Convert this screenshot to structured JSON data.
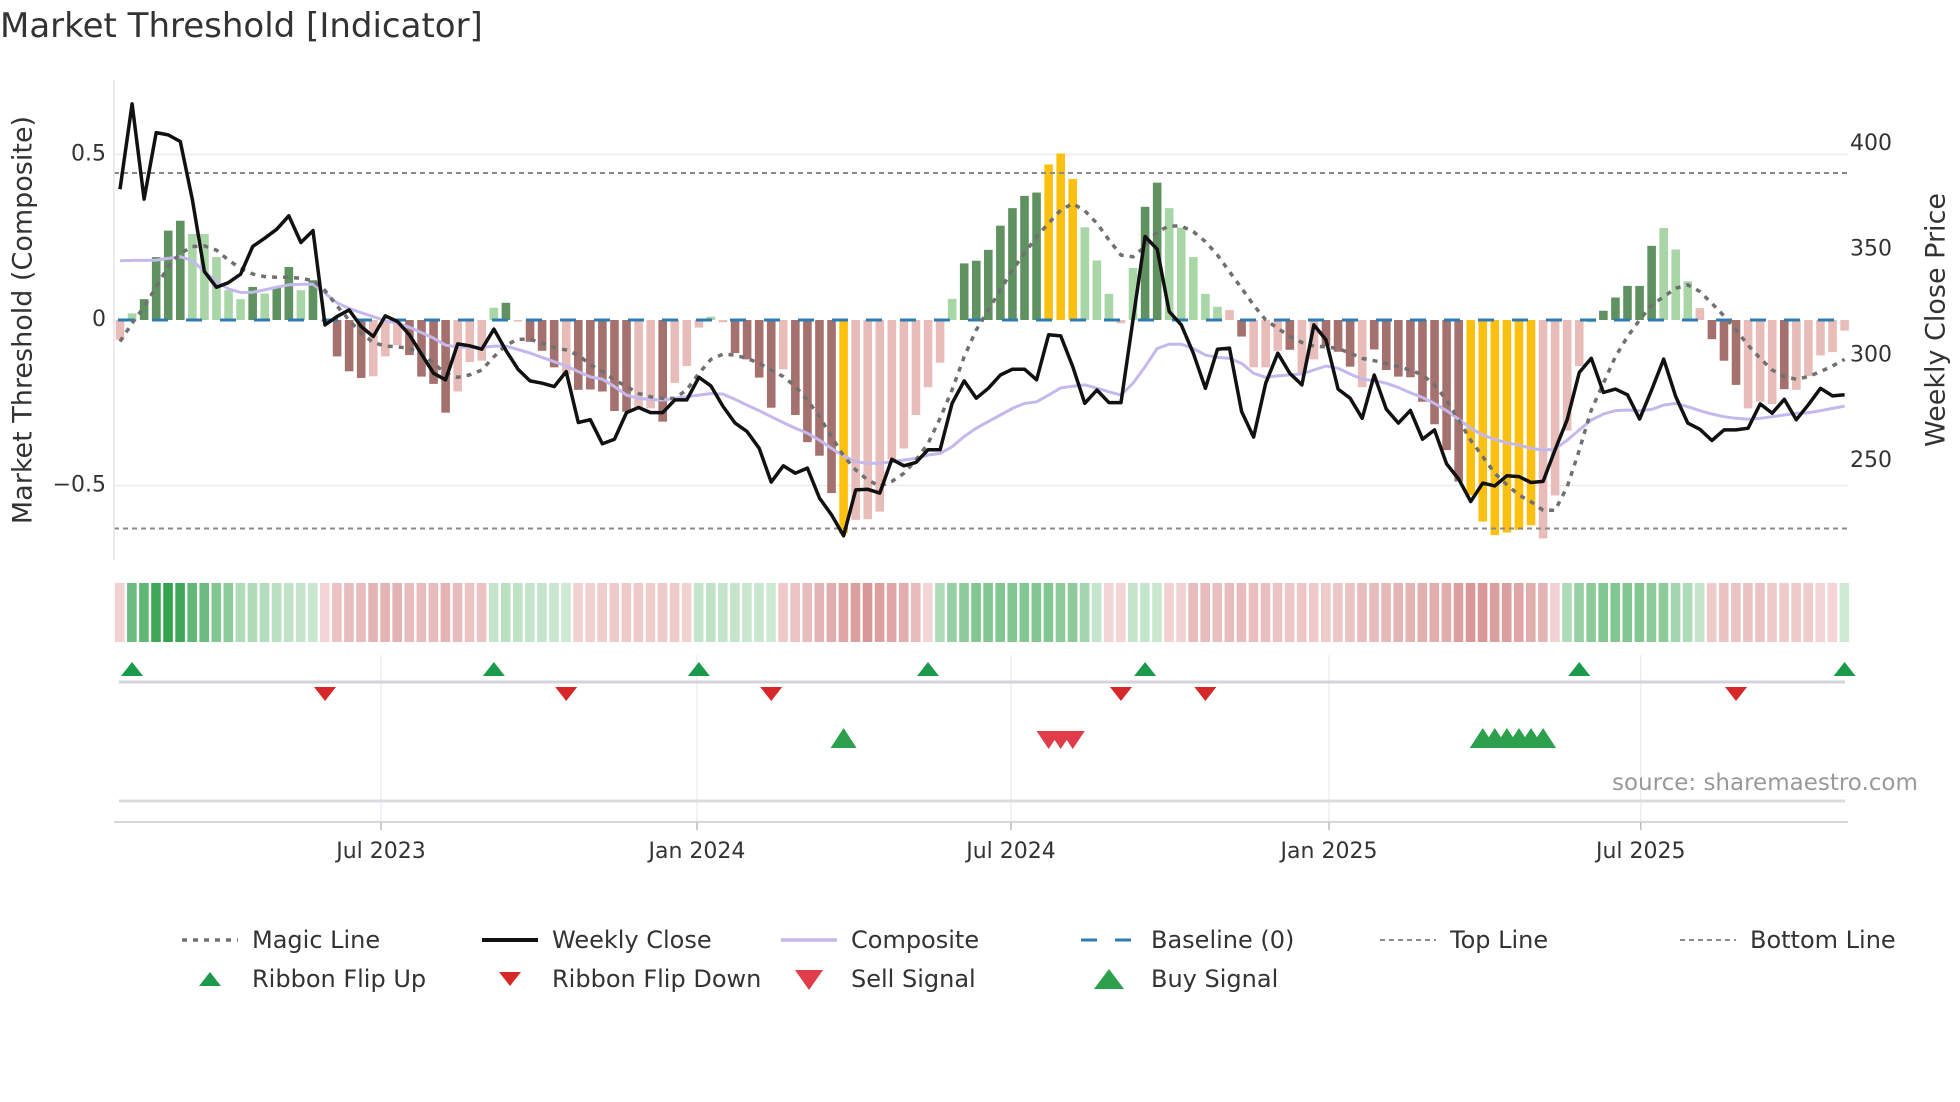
{
  "title": "Market Threshold [Indicator]",
  "source": "source: sharemaestro.com",
  "colors": {
    "bar_dark_green": "#5f9260",
    "bar_light_green": "#a9d6a6",
    "bar_dark_red": "#a5716e",
    "bar_light_red": "#e8bdb9",
    "bar_extreme": "#fcc010",
    "close": "#111111",
    "composite": "#c4b8ec",
    "magic": "#707070",
    "baseline": "#2f7cb3",
    "threshold": "#8a8a8a",
    "flip_up": "#1a9a4a",
    "flip_down": "#d62828",
    "sell": "#e03c4a",
    "buy": "#2ca04c"
  },
  "chart_data": {
    "type": "bar+line",
    "title": "Market Threshold [Indicator]",
    "ylabel_left": "Market Threshold (Composite)",
    "ylabel_right": "Weekly Close Price",
    "ylim_left": [
      -0.74,
      0.72
    ],
    "ylim_right": [
      188,
      432
    ],
    "yticks_left": [
      {
        "v": 0.5,
        "label": "0.5"
      },
      {
        "v": 0,
        "label": "0"
      },
      {
        "v": -0.5,
        "label": "−0.5"
      }
    ],
    "yticks_right": [
      {
        "v": 400,
        "label": "400"
      },
      {
        "v": 350,
        "label": "350"
      },
      {
        "v": 300,
        "label": "300"
      },
      {
        "v": 250,
        "label": "250"
      }
    ],
    "xticks": [
      {
        "week": 21.64,
        "label": "Jul 2023"
      },
      {
        "week": 47.84,
        "label": "Jan 2024"
      },
      {
        "week": 73.88,
        "label": "Jul 2024"
      },
      {
        "week": 100.25,
        "label": "Jan 2025"
      },
      {
        "week": 126.1,
        "label": "Jul 2025"
      }
    ],
    "top_line": 0.444,
    "bottom_line": -0.63,
    "baseline": 0,
    "composite_bars": [
      -0.06,
      0.02,
      0.063,
      0.19,
      0.27,
      0.3,
      0.26,
      0.26,
      0.19,
      0.09,
      0.063,
      0.1,
      0.08,
      0.1,
      0.16,
      0.09,
      0.12,
      0,
      -0.11,
      -0.155,
      -0.175,
      -0.17,
      -0.11,
      -0.076,
      -0.106,
      -0.171,
      -0.193,
      -0.28,
      -0.216,
      -0.127,
      -0.123,
      0.037,
      0.052,
      -0.005,
      -0.066,
      -0.093,
      -0.143,
      -0.164,
      -0.211,
      -0.21,
      -0.216,
      -0.275,
      -0.277,
      -0.267,
      -0.267,
      -0.307,
      -0.19,
      -0.139,
      -0.023,
      0.01,
      -0.007,
      -0.1,
      -0.119,
      -0.174,
      -0.265,
      -0.149,
      -0.287,
      -0.369,
      -0.41,
      -0.523,
      -0.644,
      -0.604,
      -0.602,
      -0.579,
      -0.421,
      -0.388,
      -0.287,
      -0.203,
      -0.129,
      0.064,
      0.171,
      0.179,
      0.212,
      0.285,
      0.338,
      0.375,
      0.385,
      0.47,
      0.503,
      0.426,
      0.28,
      0.18,
      0.079,
      -0.01,
      0.157,
      0.342,
      0.415,
      0.338,
      0.279,
      0.19,
      0.079,
      0.04,
      0.03,
      -0.05,
      -0.143,
      -0.143,
      -0.093,
      -0.09,
      -0.16,
      -0.119,
      -0.079,
      -0.096,
      -0.141,
      -0.203,
      -0.089,
      -0.151,
      -0.171,
      -0.173,
      -0.247,
      -0.315,
      -0.393,
      -0.488,
      -0.529,
      -0.609,
      -0.65,
      -0.642,
      -0.634,
      -0.62,
      -0.66,
      -0.53,
      -0.334,
      -0.139,
      -0.007,
      0.028,
      0.068,
      0.103,
      0.103,
      0.224,
      0.278,
      0.213,
      0.117,
      0.036,
      -0.058,
      -0.123,
      -0.196,
      -0.267,
      -0.247,
      -0.254,
      -0.209,
      -0.211,
      -0.169,
      -0.107,
      -0.097,
      -0.032
    ],
    "bar_states": "rgGGGGgggggGgGGgGrRRRrrrRRRRrrrgGrRRRrRRRRRrrRrrrgrRRRRrRRRRYrrrrrrrrgGGGGGGGYYYgggrgGGgggggrRrrrRrrRRRrRRRRRRRRYYYYYYrrrrgGGGGGgggrRRRrrrRrrrr",
    "weekly_close": [
      378.6,
      419,
      373.9,
      405.4,
      404.3,
      401.2,
      373.6,
      339.6,
      332.2,
      334.4,
      338.4,
      351.5,
      355.4,
      359.7,
      366,
      353.4,
      359,
      314.4,
      318.4,
      321.5,
      313.6,
      308.9,
      318.7,
      316,
      309.7,
      300.5,
      291.5,
      288.4,
      305.4,
      304.5,
      302.9,
      312.4,
      302.3,
      293.4,
      287.9,
      286.8,
      285.2,
      292.3,
      268.2,
      269.5,
      258.1,
      260.3,
      272.9,
      275.3,
      272.9,
      272.9,
      278.9,
      278.9,
      289.6,
      285.5,
      275.8,
      267.9,
      263.9,
      256,
      240,
      247.7,
      244.2,
      246.6,
      232.4,
      224.5,
      214.6,
      236.3,
      236.6,
      234.8,
      250.8,
      247.7,
      249.3,
      255.3,
      255.3,
      277.3,
      287.9,
      279.7,
      284.4,
      290.7,
      293.4,
      293.4,
      288.4,
      309.7,
      309.2,
      294.7,
      277.3,
      283.6,
      277.6,
      277.6,
      316.8,
      356.2,
      350.2,
      320.7,
      314.4,
      301,
      284.4,
      302.9,
      303.4,
      273.4,
      261.3,
      286.8,
      301,
      291.5,
      286,
      314.4,
      307.3,
      284,
      279.7,
      270.2,
      290.7,
      274.5,
      267.9,
      273.9,
      260.3,
      264.7,
      248.6,
      241.4,
      230.8,
      239.5,
      238.2,
      243,
      242.6,
      239.8,
      240.3,
      255.3,
      269.5,
      291.9,
      298.6,
      282.4,
      284,
      281.3,
      269.8,
      283.6,
      298.2,
      280.5,
      267.9,
      265,
      259.7,
      264.7,
      264.7,
      265.5,
      277,
      272.6,
      279.2,
      269.5,
      276.6,
      284.4,
      280.8,
      281.3
    ],
    "composite": [
      0.179,
      0.18,
      0.18,
      0.181,
      0.186,
      0.191,
      0.18,
      0.146,
      0.116,
      0.094,
      0.083,
      0.084,
      0.091,
      0.099,
      0.106,
      0.108,
      0.108,
      0.081,
      0.052,
      0.035,
      0.022,
      0.01,
      -0.002,
      -0.01,
      -0.022,
      -0.038,
      -0.055,
      -0.076,
      -0.081,
      -0.083,
      -0.083,
      -0.079,
      -0.079,
      -0.089,
      -0.1,
      -0.113,
      -0.126,
      -0.139,
      -0.156,
      -0.172,
      -0.179,
      -0.201,
      -0.227,
      -0.237,
      -0.24,
      -0.242,
      -0.237,
      -0.232,
      -0.227,
      -0.222,
      -0.224,
      -0.24,
      -0.257,
      -0.274,
      -0.292,
      -0.31,
      -0.327,
      -0.342,
      -0.363,
      -0.388,
      -0.411,
      -0.428,
      -0.433,
      -0.433,
      -0.428,
      -0.423,
      -0.418,
      -0.408,
      -0.403,
      -0.383,
      -0.352,
      -0.327,
      -0.307,
      -0.287,
      -0.267,
      -0.252,
      -0.247,
      -0.227,
      -0.205,
      -0.2,
      -0.196,
      -0.206,
      -0.217,
      -0.227,
      -0.191,
      -0.141,
      -0.086,
      -0.073,
      -0.073,
      -0.086,
      -0.106,
      -0.113,
      -0.116,
      -0.131,
      -0.161,
      -0.173,
      -0.169,
      -0.166,
      -0.163,
      -0.151,
      -0.139,
      -0.146,
      -0.163,
      -0.179,
      -0.183,
      -0.191,
      -0.204,
      -0.22,
      -0.234,
      -0.252,
      -0.274,
      -0.3,
      -0.327,
      -0.347,
      -0.361,
      -0.371,
      -0.378,
      -0.388,
      -0.393,
      -0.39,
      -0.363,
      -0.332,
      -0.302,
      -0.284,
      -0.274,
      -0.272,
      -0.274,
      -0.27,
      -0.257,
      -0.252,
      -0.262,
      -0.274,
      -0.284,
      -0.292,
      -0.297,
      -0.3,
      -0.297,
      -0.292,
      -0.287,
      -0.282,
      -0.28,
      -0.274,
      -0.267,
      -0.26
    ],
    "magic_line": [
      -0.065,
      -0.01,
      0.04,
      0.1,
      0.161,
      0.201,
      0.222,
      0.224,
      0.211,
      0.181,
      0.156,
      0.139,
      0.131,
      0.129,
      0.129,
      0.126,
      0.119,
      0.089,
      0.042,
      0,
      -0.04,
      -0.068,
      -0.079,
      -0.081,
      -0.086,
      -0.1,
      -0.131,
      -0.161,
      -0.173,
      -0.166,
      -0.151,
      -0.111,
      -0.076,
      -0.058,
      -0.058,
      -0.07,
      -0.083,
      -0.091,
      -0.106,
      -0.135,
      -0.156,
      -0.181,
      -0.201,
      -0.222,
      -0.232,
      -0.237,
      -0.237,
      -0.211,
      -0.161,
      -0.119,
      -0.103,
      -0.106,
      -0.116,
      -0.131,
      -0.151,
      -0.171,
      -0.201,
      -0.242,
      -0.292,
      -0.352,
      -0.411,
      -0.453,
      -0.483,
      -0.502,
      -0.488,
      -0.463,
      -0.423,
      -0.373,
      -0.297,
      -0.211,
      -0.111,
      -0.03,
      0.03,
      0.091,
      0.151,
      0.201,
      0.252,
      0.292,
      0.332,
      0.352,
      0.33,
      0.292,
      0.242,
      0.196,
      0.191,
      0.222,
      0.267,
      0.284,
      0.284,
      0.267,
      0.237,
      0.196,
      0.146,
      0.096,
      0.045,
      0,
      -0.025,
      -0.05,
      -0.068,
      -0.079,
      -0.081,
      -0.086,
      -0.1,
      -0.116,
      -0.123,
      -0.131,
      -0.141,
      -0.151,
      -0.166,
      -0.196,
      -0.242,
      -0.302,
      -0.363,
      -0.413,
      -0.463,
      -0.498,
      -0.529,
      -0.549,
      -0.575,
      -0.575,
      -0.504,
      -0.393,
      -0.272,
      -0.191,
      -0.111,
      -0.05,
      0,
      0.045,
      0.07,
      0.096,
      0.106,
      0.086,
      0.05,
      0.012,
      -0.03,
      -0.076,
      -0.116,
      -0.151,
      -0.171,
      -0.179,
      -0.171,
      -0.156,
      -0.139,
      -0.119
    ],
    "ribbon_strength": [
      -0.15,
      0.6,
      0.65,
      0.8,
      0.85,
      0.8,
      0.65,
      0.6,
      0.5,
      0.45,
      0.3,
      0.3,
      0.28,
      0.25,
      0.22,
      0.2,
      0.18,
      -0.12,
      -0.25,
      -0.3,
      -0.3,
      -0.35,
      -0.35,
      -0.35,
      -0.3,
      -0.3,
      -0.3,
      -0.35,
      -0.3,
      -0.25,
      -0.25,
      0.2,
      0.25,
      0.22,
      0.2,
      0.2,
      0.18,
      0.15,
      -0.15,
      -0.15,
      -0.18,
      -0.2,
      -0.2,
      -0.2,
      -0.18,
      -0.2,
      -0.2,
      -0.15,
      0.2,
      0.22,
      0.2,
      0.2,
      0.18,
      0.18,
      0.15,
      -0.2,
      -0.25,
      -0.3,
      -0.35,
      -0.4,
      -0.45,
      -0.5,
      -0.55,
      -0.5,
      -0.45,
      -0.4,
      -0.3,
      -0.12,
      0.3,
      0.4,
      0.45,
      0.5,
      0.5,
      0.5,
      0.5,
      0.5,
      0.5,
      0.5,
      0.45,
      0.45,
      0.35,
      0.2,
      -0.12,
      -0.12,
      0.2,
      0.2,
      0.18,
      -0.15,
      -0.15,
      -0.3,
      -0.3,
      -0.28,
      -0.3,
      -0.3,
      -0.28,
      -0.28,
      -0.25,
      -0.22,
      -0.22,
      -0.2,
      -0.2,
      -0.22,
      -0.25,
      -0.3,
      -0.3,
      -0.32,
      -0.35,
      -0.35,
      -0.38,
      -0.4,
      -0.4,
      -0.5,
      -0.55,
      -0.55,
      -0.5,
      -0.5,
      -0.45,
      -0.4,
      -0.35,
      -0.15,
      0.3,
      0.4,
      0.45,
      0.5,
      0.5,
      0.5,
      0.5,
      0.45,
      0.45,
      0.35,
      0.3,
      0.2,
      -0.2,
      -0.25,
      -0.25,
      -0.25,
      -0.25,
      -0.2,
      -0.2,
      -0.2,
      -0.18,
      -0.12,
      -0.12,
      0.15
    ],
    "ribbon_flip_up_weeks": [
      1,
      31,
      48,
      67,
      85,
      121,
      143
    ],
    "ribbon_flip_down_weeks": [
      17,
      37,
      54,
      83,
      90,
      134
    ],
    "buy_signal_weeks": [
      60,
      113,
      114,
      115,
      116,
      117,
      118
    ],
    "sell_signal_weeks": [
      77,
      78,
      79
    ],
    "legend": [
      {
        "label": "Magic Line",
        "handle": "dotted-line"
      },
      {
        "label": "Weekly Close",
        "handle": "solid-line"
      },
      {
        "label": "Composite",
        "handle": "composite-line"
      },
      {
        "label": "Baseline (0)",
        "handle": "dashed-blue"
      },
      {
        "label": "Top Line",
        "handle": "dashed-gray"
      },
      {
        "label": "Bottom Line",
        "handle": "dashed-gray"
      },
      {
        "label": "Ribbon Flip Up",
        "handle": "triangle-up-small"
      },
      {
        "label": "Ribbon Flip Down",
        "handle": "triangle-down-small"
      },
      {
        "label": "Sell Signal",
        "handle": "triangle-down-large"
      },
      {
        "label": "Buy Signal",
        "handle": "triangle-up-large"
      }
    ],
    "legend_position": "bottom"
  }
}
